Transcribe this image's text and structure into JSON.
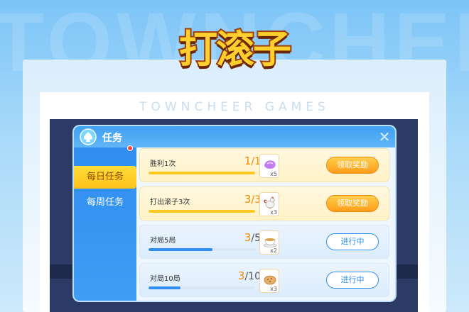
{
  "background_text": "TOWNCHEE",
  "logo_text": "打滚子",
  "brand_text": "TOWNCHEER GAMES",
  "panel": {
    "title": "任务",
    "close_label": "✕"
  },
  "tabs": [
    {
      "label": "每日任务",
      "active": true,
      "badge": true
    },
    {
      "label": "每周任务",
      "active": false,
      "badge": false
    }
  ],
  "tasks": [
    {
      "name": "胜利1次",
      "progress": "1",
      "total": "1",
      "fraction": 1.0,
      "reward_icon": "purple-gem-icon",
      "reward_qty": "x5",
      "button": "领取奖励",
      "state": "claim"
    },
    {
      "name": "打出滚子3次",
      "progress": "3",
      "total": "3",
      "fraction": 1.0,
      "reward_icon": "rooster-icon",
      "reward_qty": "x3",
      "button": "领取奖励",
      "state": "claim"
    },
    {
      "name": "对局5局",
      "progress": "3",
      "total": "5",
      "fraction": 0.6,
      "reward_icon": "tea-cup-icon",
      "reward_qty": "x2",
      "button": "进行中",
      "state": "ongoing"
    },
    {
      "name": "对局10局",
      "progress": "3",
      "total": "10",
      "fraction": 0.3,
      "reward_icon": "cookie-icon",
      "reward_qty": "x3",
      "button": "进行中",
      "state": "ongoing"
    }
  ],
  "colors": {
    "accent_blue": "#2f8ef0",
    "accent_orange": "#ff9d1a",
    "progress_yellow": "#ffc820"
  }
}
